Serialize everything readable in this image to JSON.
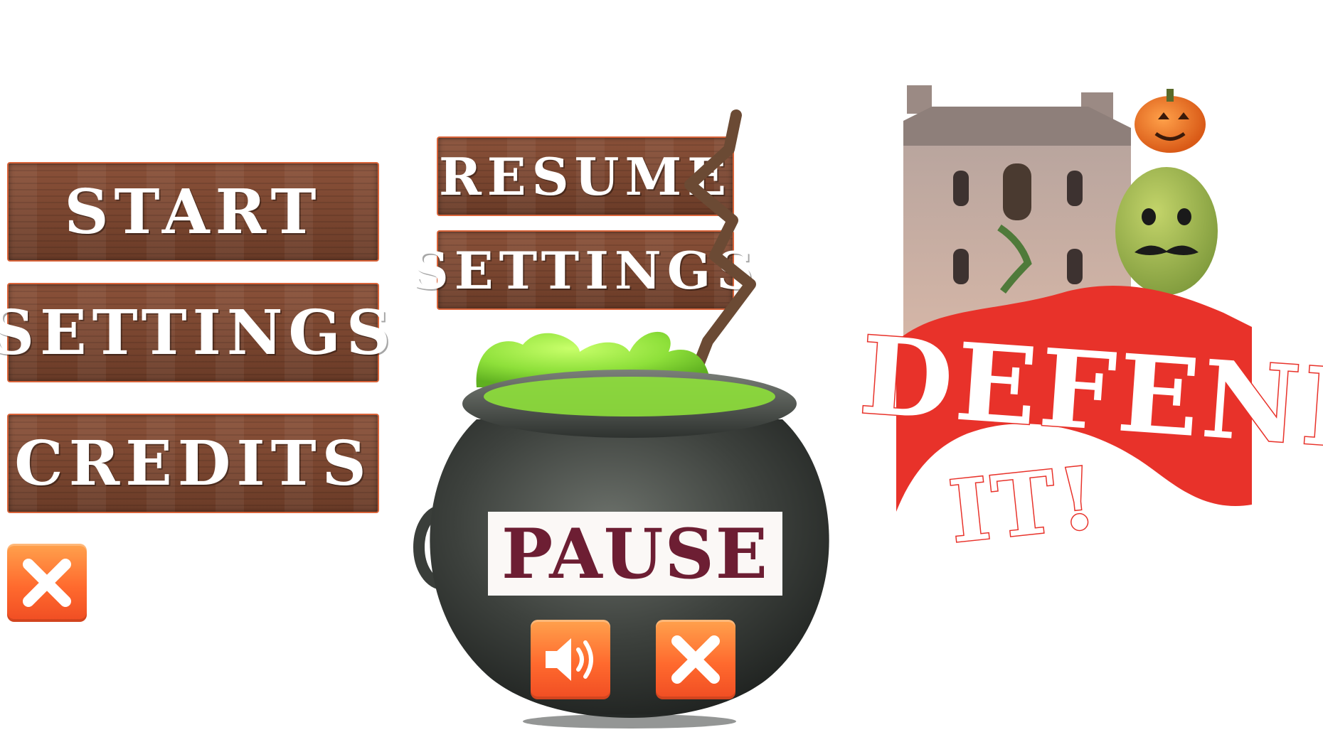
{
  "main_menu": {
    "start_label": "START",
    "settings_label": "SETTINGS",
    "credits_label": "CREDITS"
  },
  "pause_menu": {
    "resume_label": "RESUME",
    "settings_label": "SETTINGS",
    "pause_title": "PAUSE"
  },
  "logo": {
    "line1": "DEFEND",
    "line2": "IT!"
  },
  "icons": {
    "close": "close-icon",
    "sound": "speaker-icon"
  },
  "colors": {
    "wood": "#7a4630",
    "wood_border": "#d9643a",
    "button_orange": "#ff6a2e",
    "pause_text": "#6d1e33",
    "banner_red": "#e8322a",
    "slime_green": "#8ee03a"
  }
}
